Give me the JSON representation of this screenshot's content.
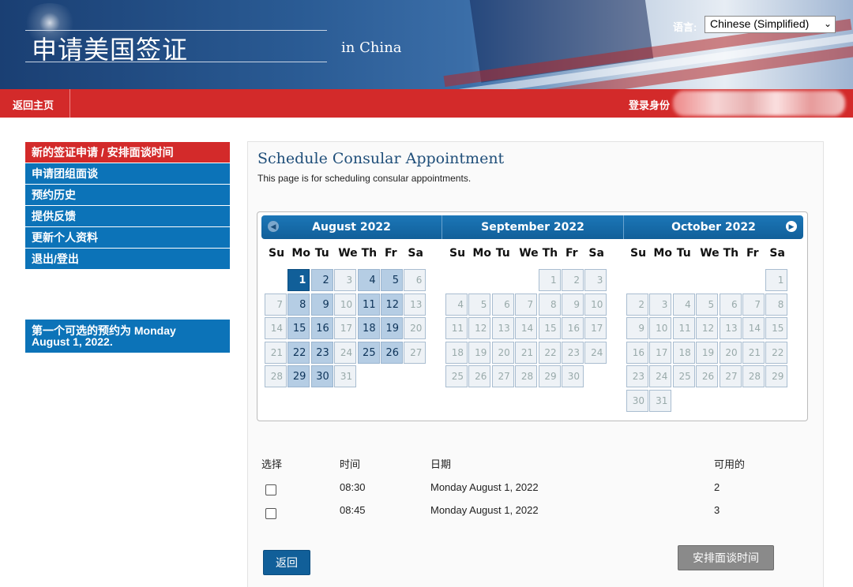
{
  "header": {
    "site_title": "申请美国签证",
    "in_country": "in China",
    "language_label": "语言:",
    "language_value": "Chinese (Simplified)"
  },
  "topbar": {
    "home": "返回主页",
    "login_label": "登录身份"
  },
  "sidebar": {
    "items": [
      {
        "label": "新的签证申请 / 安排面谈时间",
        "active": true
      },
      {
        "label": "申请团组面谈",
        "active": false
      },
      {
        "label": "预约历史",
        "active": false
      },
      {
        "label": "提供反馈",
        "active": false
      },
      {
        "label": "更新个人资料",
        "active": false
      },
      {
        "label": "退出/登出",
        "active": false
      }
    ],
    "notice_line1": "第一个可选的预约为 Monday",
    "notice_line2": "August 1, 2022."
  },
  "main": {
    "heading": "Schedule Consular Appointment",
    "subheading": "This page is for scheduling consular appointments."
  },
  "calendar": {
    "weekdays": [
      "Su",
      "Mo",
      "Tu",
      "We",
      "Th",
      "Fr",
      "Sa"
    ],
    "months": [
      {
        "title": "August 2022",
        "first_weekday": 1,
        "days": 31,
        "available": [
          1,
          2,
          4,
          5,
          8,
          9,
          11,
          12,
          15,
          16,
          18,
          19,
          22,
          23,
          25,
          26,
          29,
          30
        ],
        "selected": 1
      },
      {
        "title": "September 2022",
        "first_weekday": 4,
        "days": 30,
        "available": [],
        "selected": null
      },
      {
        "title": "October 2022",
        "first_weekday": 6,
        "days": 31,
        "available": [],
        "selected": null
      }
    ]
  },
  "table": {
    "headers": {
      "select": "选择",
      "time": "时间",
      "date": "日期",
      "available": "可用的"
    },
    "rows": [
      {
        "time": "08:30",
        "date": "Monday August 1, 2022",
        "available": "2"
      },
      {
        "time": "08:45",
        "date": "Monday August 1, 2022",
        "available": "3"
      }
    ]
  },
  "buttons": {
    "back": "返回",
    "schedule": "安排面谈时间"
  },
  "colors": {
    "brand_blue": "#0c73b8",
    "brand_red": "#d32a2a",
    "calendar_available": "#b5cde4",
    "calendar_selected": "#115f99"
  }
}
